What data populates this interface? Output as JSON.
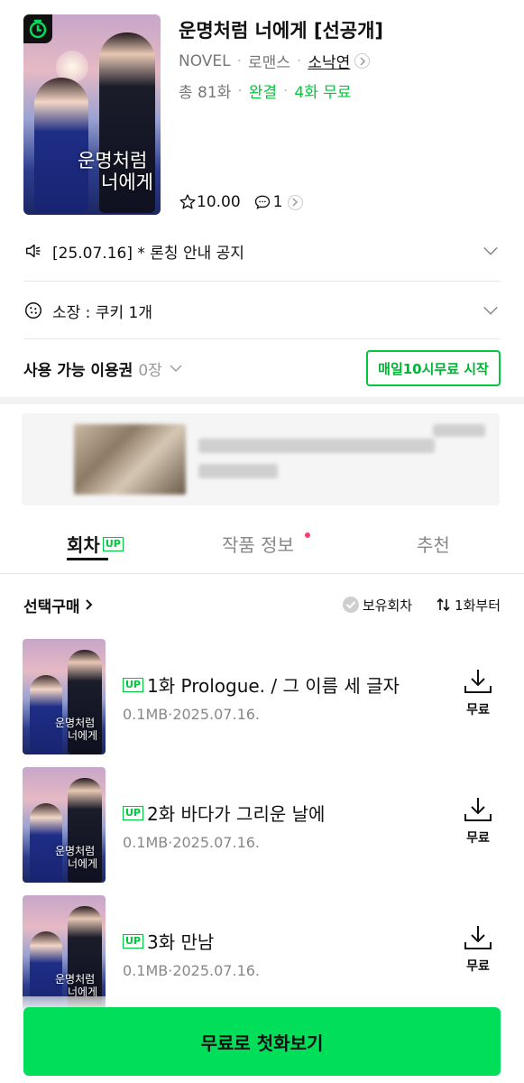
{
  "work": {
    "title": "운명처럼 너에게 [선공개]",
    "cover_text_line1": "운명처럼",
    "cover_text_line2": "너에게",
    "format": "NOVEL",
    "genre": "로맨스",
    "author": "소낙연",
    "total": "총 81화",
    "status": "완결",
    "free_episodes": "4화 무료",
    "rating": "10.00",
    "comments": "1"
  },
  "notice": {
    "text": "[25.07.16] * 론칭 안내 공지"
  },
  "owned": {
    "text": "소장 : 쿠키 1개"
  },
  "ticket": {
    "label": "사용 가능 이용권",
    "count": "0장",
    "free_button": "매일10시무료 시작"
  },
  "tabs": [
    {
      "label": "회차",
      "badge": "UP"
    },
    {
      "label": "작품 정보"
    },
    {
      "label": "추천"
    }
  ],
  "list_header": {
    "select_buy": "선택구매",
    "owned_filter": "보유회차",
    "sort": "1화부터"
  },
  "episodes": [
    {
      "badge": "UP",
      "title": "1화 Prologue. / 그 이름 세 글자",
      "meta": "0.1MB·2025.07.16.",
      "price": "무료",
      "thumb_line1": "운명처럼",
      "thumb_line2": "너에게"
    },
    {
      "badge": "UP",
      "title": "2화 바다가 그리운 날에",
      "meta": "0.1MB·2025.07.16.",
      "price": "무료",
      "thumb_line1": "운명처럼",
      "thumb_line2": "너에게"
    },
    {
      "badge": "UP",
      "title": "3화 만남",
      "meta": "0.1MB·2025.07.16.",
      "price": "무료",
      "thumb_line1": "운명처럼",
      "thumb_line2": "너에게"
    }
  ],
  "cta": {
    "label": "무료로 첫화보기"
  },
  "colors": {
    "accent": "#00c73c",
    "cta": "#00de5a",
    "text": "#111111",
    "muted": "#888888"
  }
}
